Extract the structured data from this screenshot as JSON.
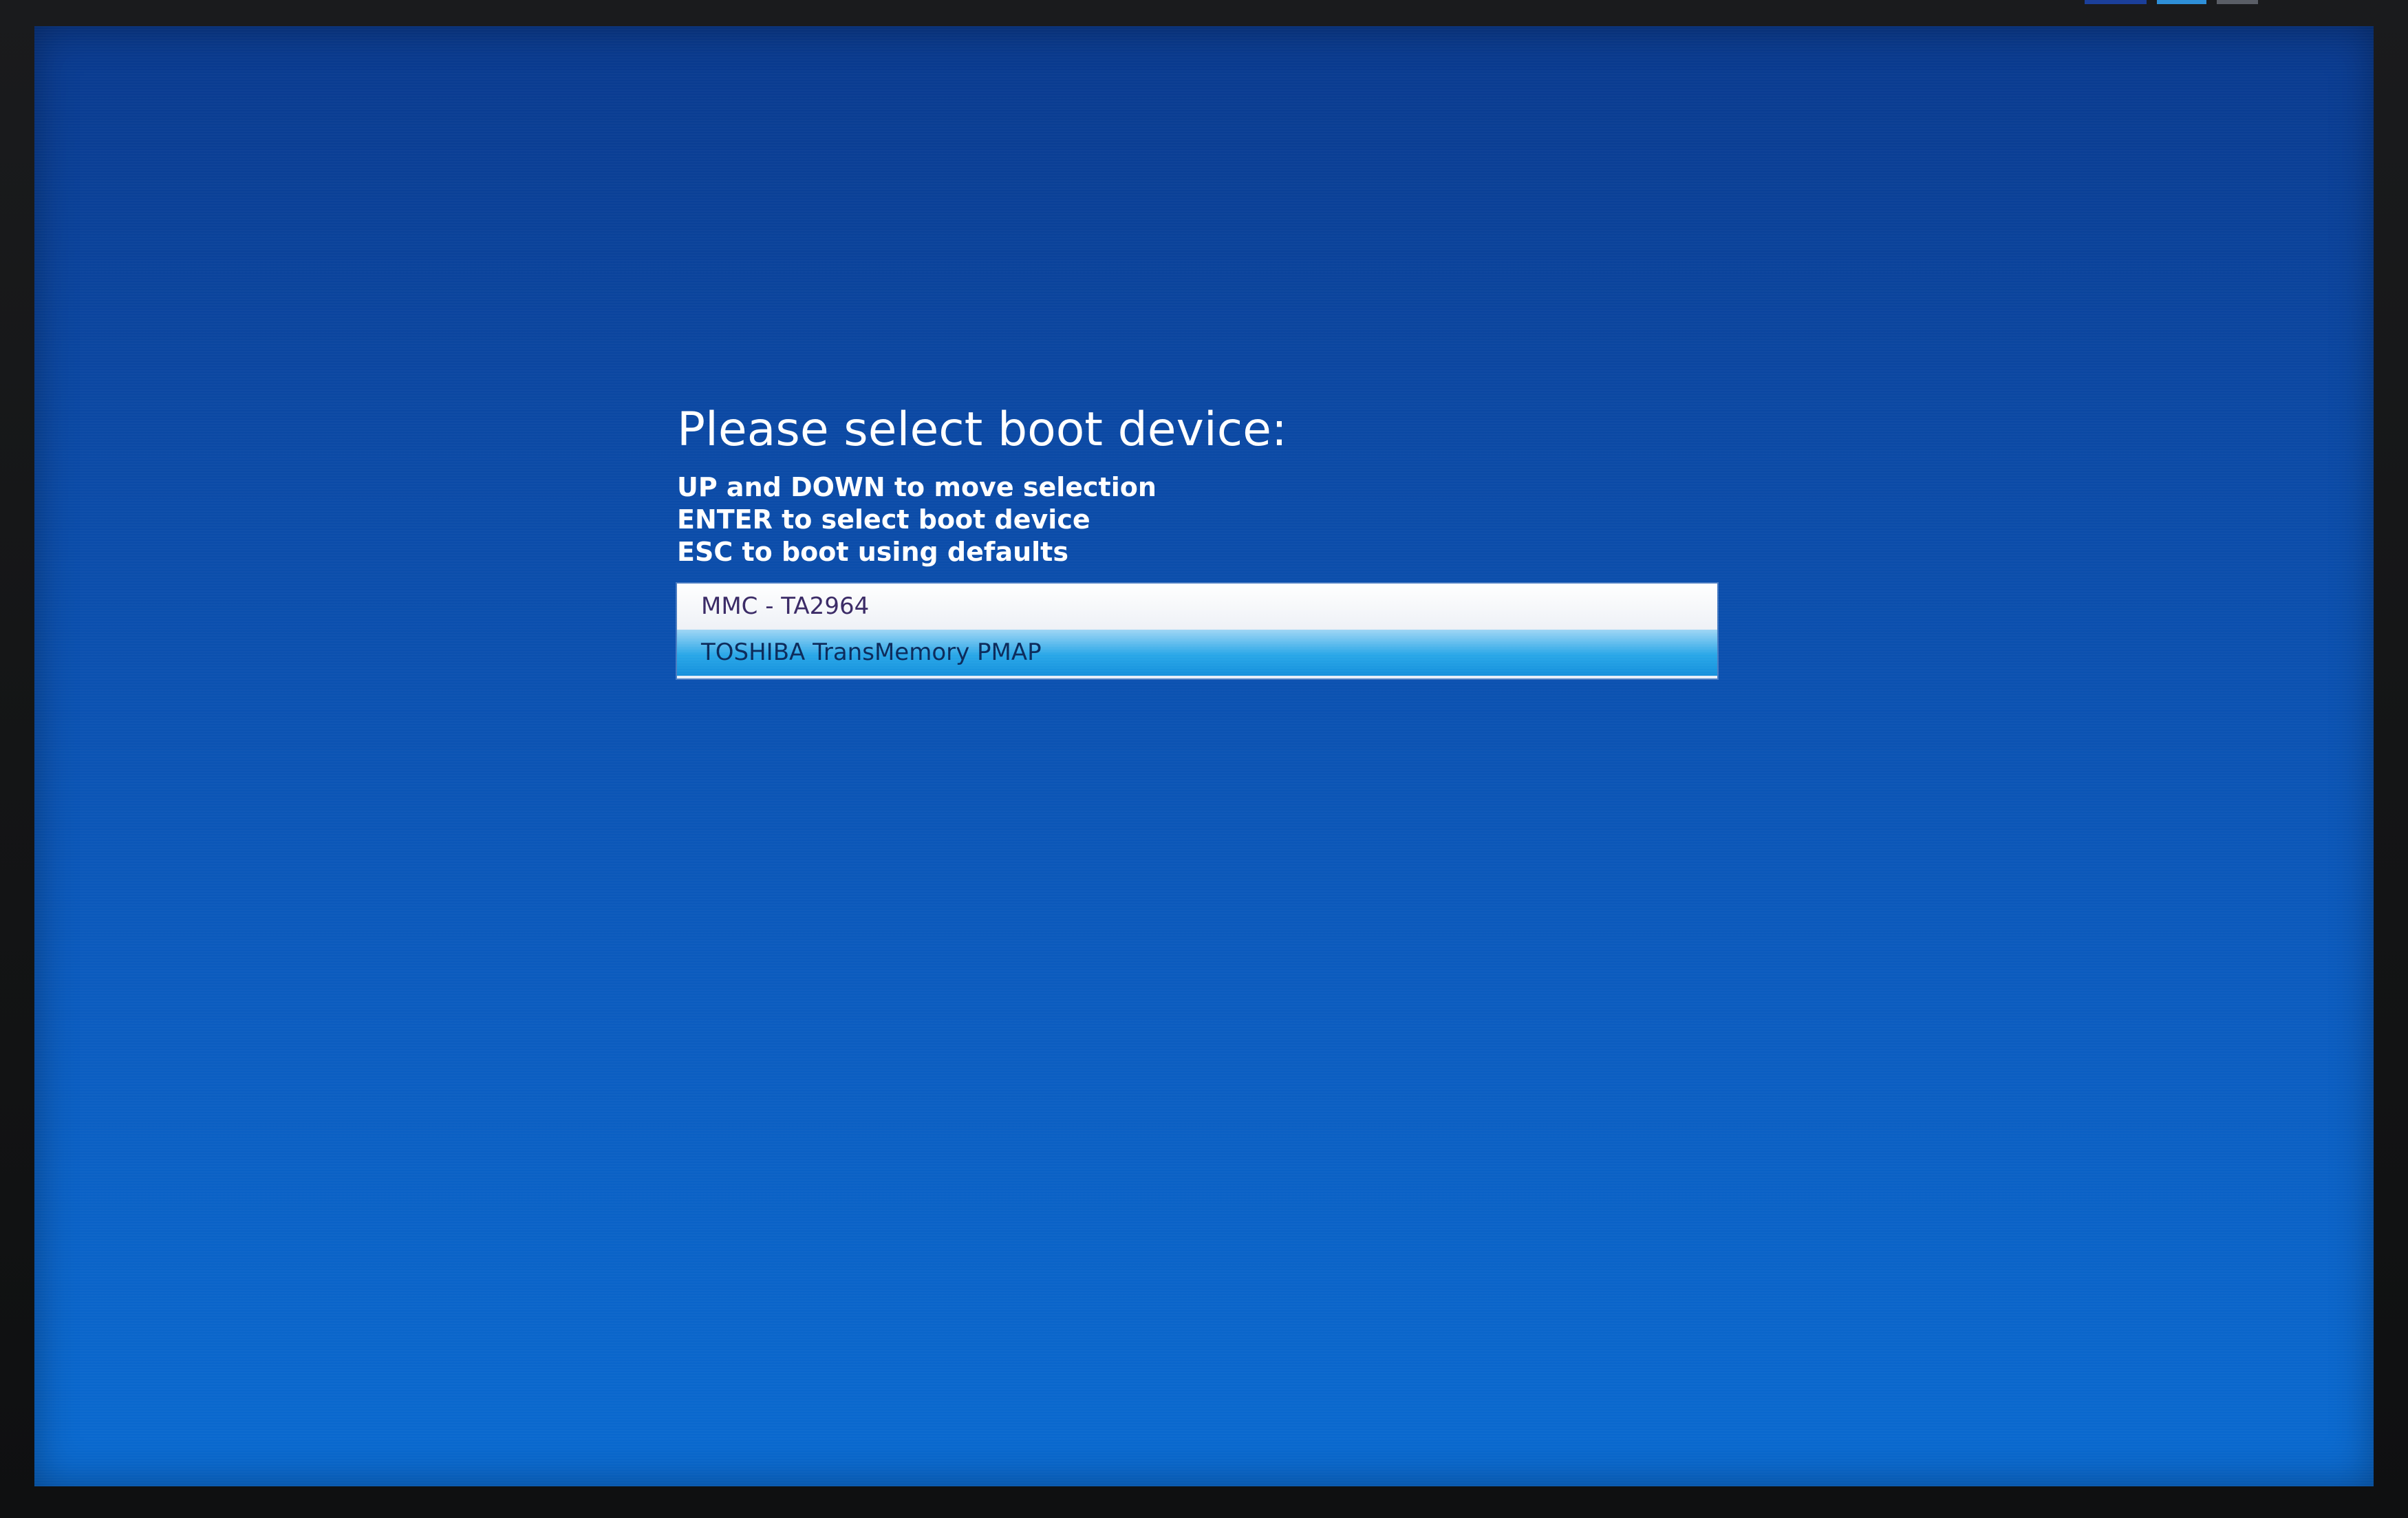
{
  "boot_menu": {
    "title": "Please select boot device:",
    "instructions": [
      "UP and DOWN to move selection",
      "ENTER to select boot device",
      "ESC to boot using defaults"
    ],
    "devices": [
      {
        "label": "MMC - TA2964",
        "selected": false
      },
      {
        "label": "TOSHIBA TransMemory PMAP",
        "selected": true
      }
    ]
  },
  "colors": {
    "background_top": "#0a3a8e",
    "background_bottom": "#0a6ad0",
    "selection": "#29a7e8",
    "text": "#ffffff"
  }
}
